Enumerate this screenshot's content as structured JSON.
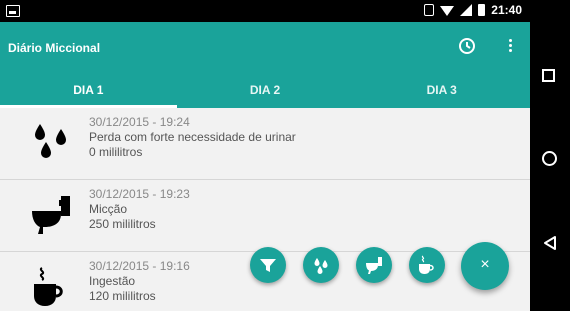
{
  "status_bar": {
    "time": "21:40"
  },
  "app": {
    "title": "Diário Miccional"
  },
  "tabs": [
    {
      "label": "DIA 1",
      "active": true
    },
    {
      "label": "DIA 2",
      "active": false
    },
    {
      "label": "DIA 3",
      "active": false
    }
  ],
  "entries": [
    {
      "icon": "water-drops-icon",
      "datetime": "30/12/2015 - 19:24",
      "type": "Perda com forte necessidade de urinar",
      "amount": "0 mililitros"
    },
    {
      "icon": "toilet-icon",
      "datetime": "30/12/2015 - 19:23",
      "type": "Micção",
      "amount": "250 mililitros"
    },
    {
      "icon": "coffee-cup-icon",
      "datetime": "30/12/2015 - 19:16",
      "type": "Ingestão",
      "amount": "120 mililitros"
    }
  ],
  "fab": {
    "close_label": "×"
  },
  "colors": {
    "primary": "#1aa39a",
    "background": "#f2f2f2"
  },
  "nav_icons": [
    "recents-icon",
    "home-icon",
    "back-icon"
  ]
}
